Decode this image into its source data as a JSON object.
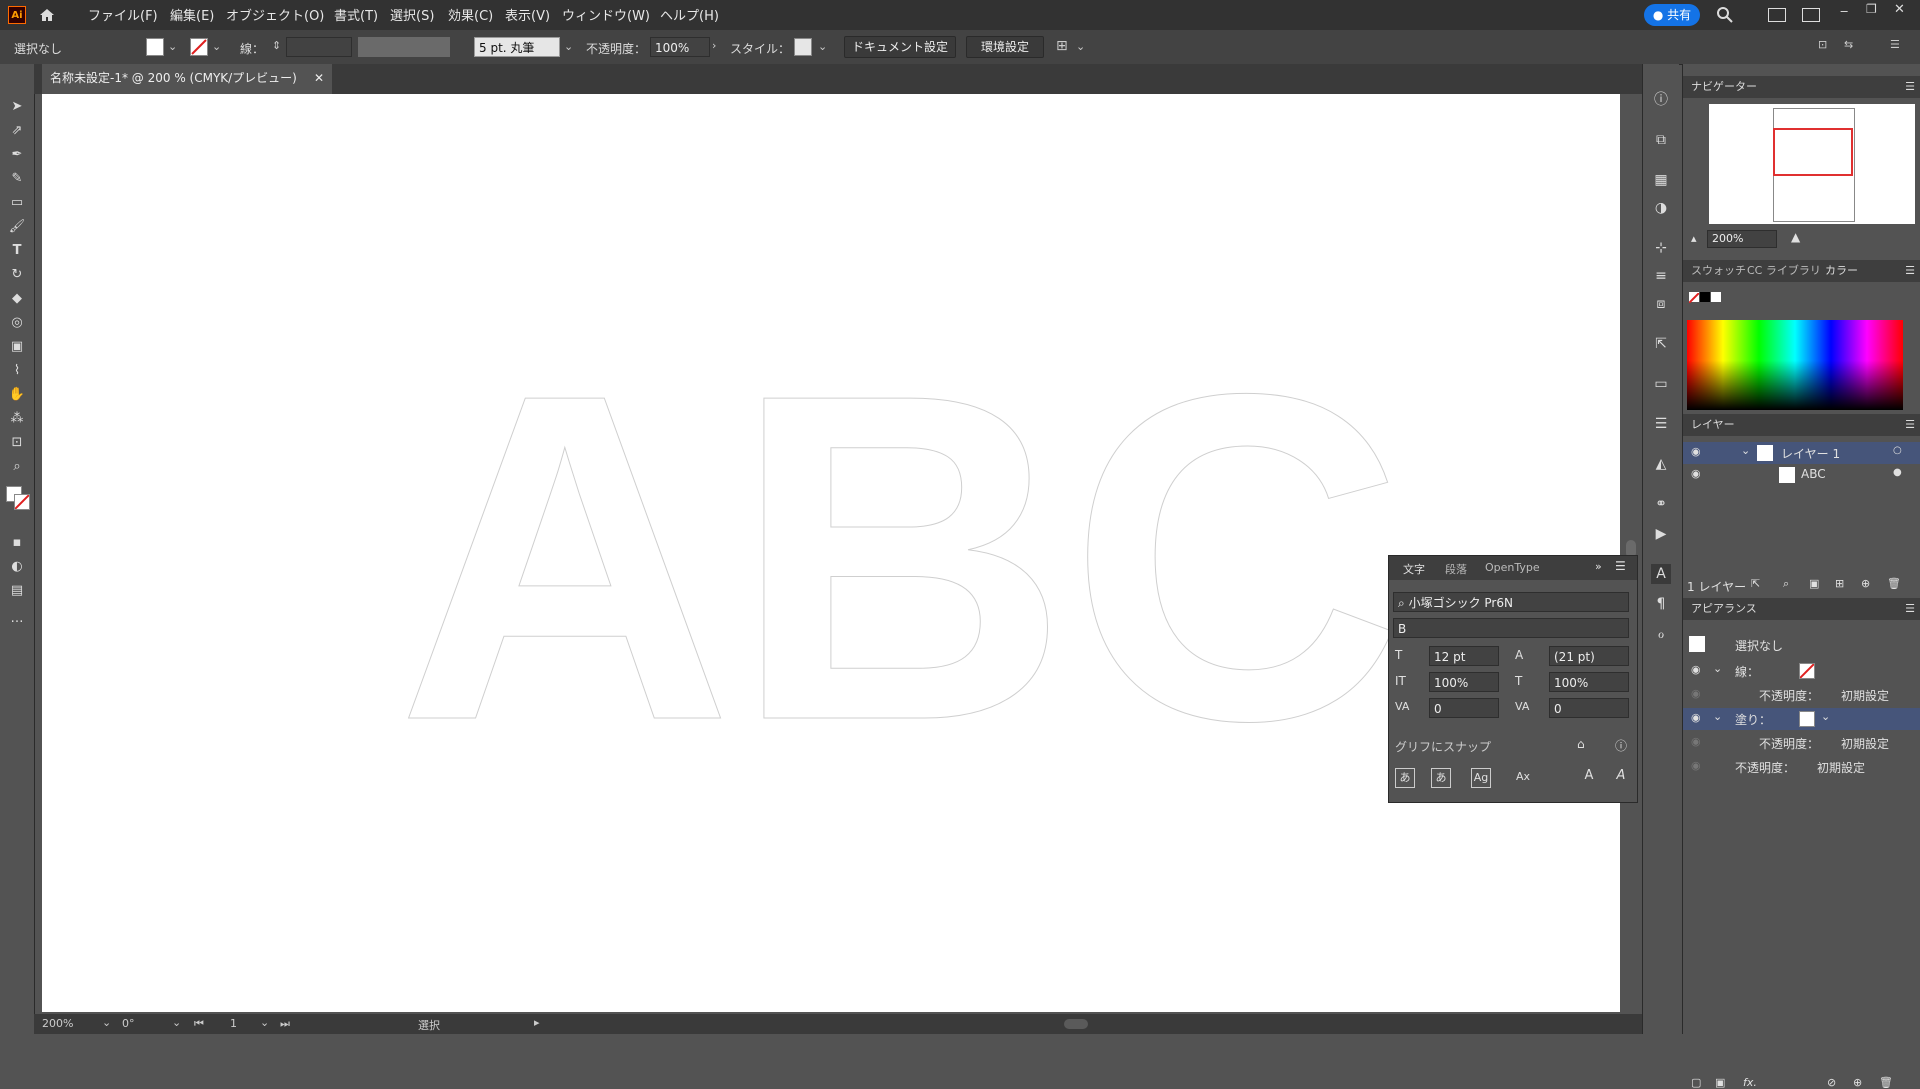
{
  "menubar": {
    "logo": "Ai",
    "items": [
      "ファイル(F)",
      "編集(E)",
      "オブジェクト(O)",
      "書式(T)",
      "選択(S)",
      "効果(C)",
      "表示(V)",
      "ウィンドウ(W)",
      "ヘルプ(H)"
    ],
    "share_label": "共有"
  },
  "controlbar": {
    "selection": "選択なし",
    "stroke_label": "線：",
    "brush_preset": "5 pt. 丸筆",
    "opacity_label": "不透明度：",
    "opacity_value": "100%",
    "style_label": "スタイル：",
    "doc_settings": "ドキュメント設定",
    "preferences": "環境設定"
  },
  "document": {
    "tab_title": "名称未設定-1* @ 200 % (CMYK/プレビュー)"
  },
  "canvas": {
    "art_text": "ABC"
  },
  "statusbar": {
    "zoom": "200%",
    "rotation": "0°",
    "artboard": "1",
    "status_text": "選択"
  },
  "navigator": {
    "title": "ナビゲーター",
    "zoom": "200%"
  },
  "color_tabs": [
    "スウォッチ",
    "CC ライブラリ",
    "カラー"
  ],
  "layers": {
    "title": "レイヤー",
    "rows": [
      {
        "name": "レイヤー 1"
      },
      {
        "name": "ABC"
      }
    ],
    "count_label": "1 レイヤー"
  },
  "appearance": {
    "title": "アピアランス",
    "selection": "選択なし",
    "stroke_label": "線：",
    "stroke_opacity_label": "不透明度：",
    "stroke_opacity_value": "初期設定",
    "fill_label": "塗り：",
    "fill_opacity_label": "不透明度：",
    "fill_opacity_value": "初期設定",
    "opacity_label": "不透明度：",
    "opacity_value": "初期設定"
  },
  "character": {
    "tabs": [
      "文字",
      "段落",
      "OpenType"
    ],
    "font_family": "小塚ゴシック Pr6N",
    "font_style": "B",
    "font_size": "12 pt",
    "leading": "(21 pt)",
    "vertical_scale": "100%",
    "horizontal_scale": "100%",
    "kerning": "0",
    "tracking": "0",
    "snap_label": "グリフにスナップ"
  }
}
